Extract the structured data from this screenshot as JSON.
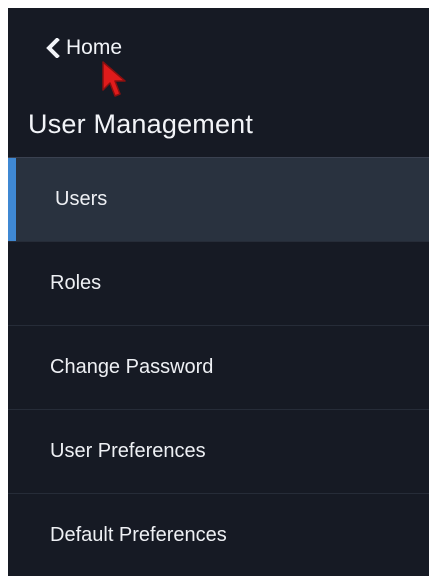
{
  "header": {
    "back_label": "Home",
    "title": "User Management"
  },
  "icons": {
    "back": "chevron-left-icon",
    "cursor": "mouse-cursor-icon"
  },
  "colors": {
    "panel_bg": "#161a24",
    "active_bg": "#29323f",
    "accent": "#3f88d3",
    "cursor": "#e01b1b"
  },
  "menu": {
    "items": [
      {
        "label": "Users",
        "active": true
      },
      {
        "label": "Roles",
        "active": false
      },
      {
        "label": "Change Password",
        "active": false
      },
      {
        "label": "User Preferences",
        "active": false
      },
      {
        "label": "Default Preferences",
        "active": false
      }
    ]
  }
}
